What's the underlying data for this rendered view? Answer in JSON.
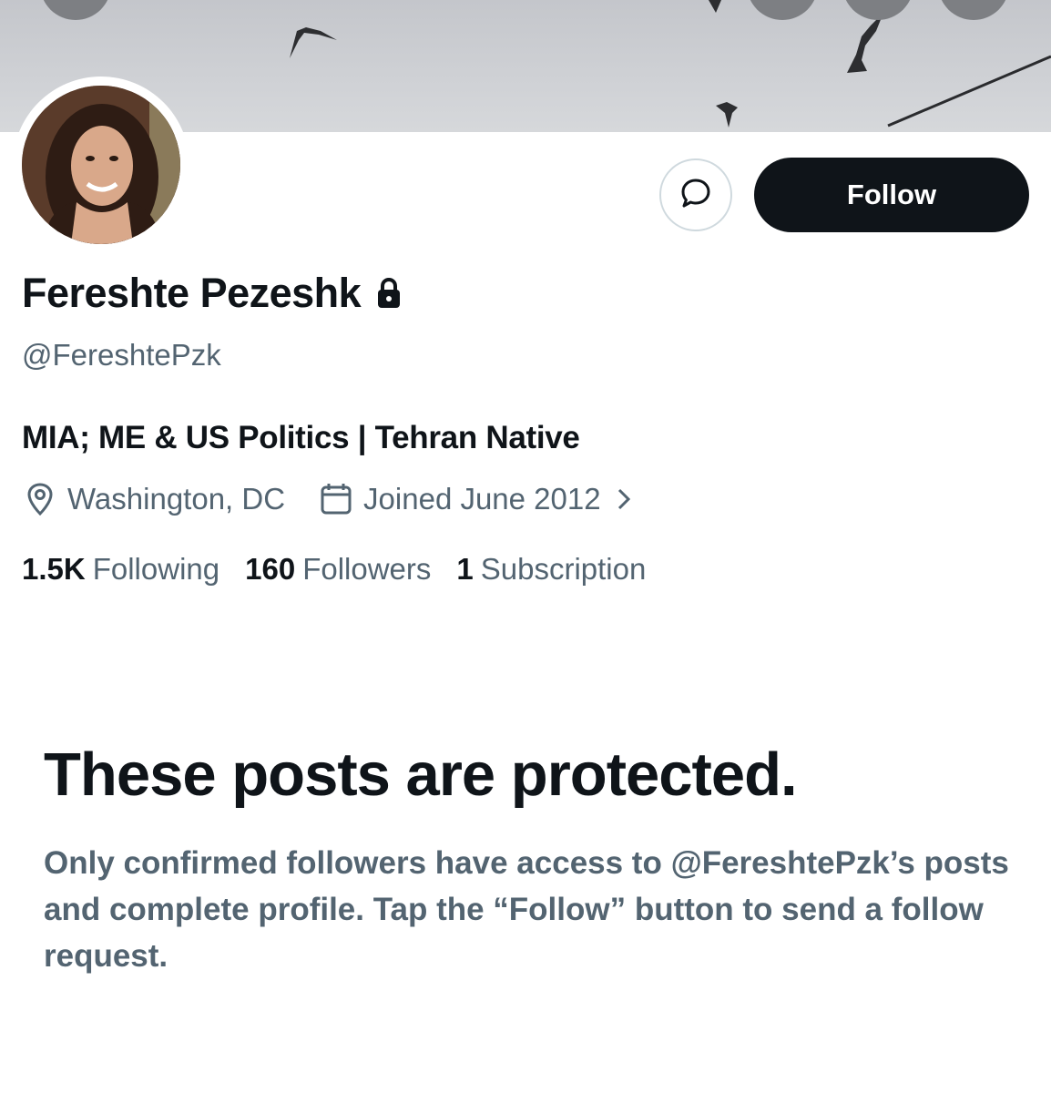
{
  "profile": {
    "name": "Fereshte Pezeshk",
    "handle": "@FereshtePzk",
    "bio": "MIA; ME & US Politics | Tehran Native",
    "location": "Washington, DC",
    "joined": "Joined June 2012",
    "icons": {
      "lock": "lock-icon",
      "location": "location-pin-icon",
      "calendar": "calendar-icon",
      "chevron": "chevron-right-icon",
      "message": "message-bubble-icon"
    }
  },
  "actions": {
    "follow_label": "Follow"
  },
  "stats": [
    {
      "value": "1.5K",
      "label": "Following"
    },
    {
      "value": "160",
      "label": "Followers"
    },
    {
      "value": "1",
      "label": "Subscription"
    }
  ],
  "protected": {
    "title": "These posts are protected.",
    "body": "Only confirmed followers have access to @FereshtePzk’s posts and complete profile. Tap the “Follow” button to send a follow request."
  },
  "colors": {
    "primary_text": "#0f1419",
    "secondary_text": "#536471",
    "button_dark": "#0f1419",
    "border": "#cfd9de"
  }
}
